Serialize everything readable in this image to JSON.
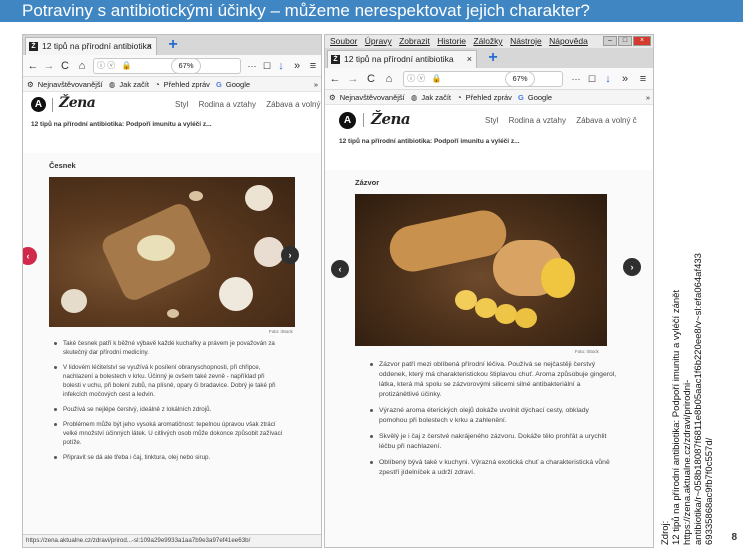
{
  "slide": {
    "title": "Potraviny s antibiotickými účinky – můžeme nerespektovat jejich charakter?",
    "page_number": "8",
    "source_lines": [
      "Zdroj:",
      "12 tipů na přírodní antibiotika: Podpoří imunitu a vyléčí zánět",
      "https://zena.aktualne.cz/zdravi/prirodni-",
      "antibiotika/r~058b18087f6811e8b05aac1f6b220ee8/v~sl:efa064af433",
      "69335868ac9fb7f0c557d/"
    ]
  },
  "left": {
    "tab_label": "12 tipů na přírodní antibiotika",
    "tab_close": "×",
    "new_tab": "+",
    "nav": {
      "back": "←",
      "forward": "→",
      "reload": "C",
      "home": "⌂",
      "info": "ⓘ ⓥ",
      "zoom": "67%",
      "more": "···",
      "pocket": "☐",
      "download": "↓",
      "overflow": "»",
      "menu": "≡"
    },
    "bookmarks": [
      "Nejnavštěvovanější",
      "Jak začít",
      "Přehled zpráv",
      "Google"
    ],
    "bookmarks_overflow": "»",
    "site": {
      "logo_letter": "A",
      "brand": "Žena",
      "nav": [
        "Styl",
        "Rodina a vztahy",
        "Zábava a volný č"
      ]
    },
    "breadcrumb": "12 tipů na přírodní antibiotika: Podpoří imunitu a vyléčí z...",
    "slide_title": "Česnek",
    "photo_credit": "Foto: iStock",
    "bullets": [
      "Také česnek patří k běžné výbavě každé kuchařky a právem je považován za skutečný dar přírodní medicíny.",
      "V lidovém léčitelství se využívá k posílení obranyschopnosti, při chřipce, nachlazení a bolestech v krku. Účinný je ovšem také zevně - například při bolesti v uchu, při bolení zubů, na plísně, opary či bradavice. Dobrý je také při infekcích močových cest a ledvin.",
      "Používá se nejlépe čerstvý, ideálně z lokálních zdrojů.",
      "Problémem může být jeho vysoká aromatičnost: tepelnou úpravou však ztrácí velké množství účinných látek. U citlivých osob může dokonce způsobit zažívací potíže.",
      "Připravit se dá ale třeba i čaj, tinktura, olej nebo sirup."
    ],
    "status_url": "https://zena.aktualne.cz/zdravi/prirod...-sl:109a29e9933a1aa7b9e3a97ef41ee63b/",
    "arrow_prev": "‹",
    "arrow_next": "›"
  },
  "right": {
    "menu": [
      "Soubor",
      "Úpravy",
      "Zobrazit",
      "Historie",
      "Záložky",
      "Nástroje",
      "Nápověda"
    ],
    "win_buttons": [
      "–",
      "□",
      "×"
    ],
    "tab_label": "12 tipů na přírodní antibiotika",
    "tab_close": "×",
    "new_tab": "+",
    "nav": {
      "back": "←",
      "forward": "→",
      "reload": "C",
      "home": "⌂",
      "info": "ⓘ ⓥ",
      "zoom": "67%",
      "more": "···",
      "pocket": "☐",
      "download": "↓",
      "overflow": "»",
      "menu": "≡"
    },
    "bookmarks": [
      "Nejnavštěvovanější",
      "Jak začít",
      "Přehled zpráv",
      "Google"
    ],
    "bookmarks_overflow": "»",
    "site": {
      "logo_letter": "A",
      "brand": "Žena",
      "nav": [
        "Styl",
        "Rodina a vztahy",
        "Zábava a volný č"
      ]
    },
    "breadcrumb": "12 tipů na přírodní antibiotika: Podpoří imunitu a vyléčí z...",
    "slide_title": "Zázvor",
    "photo_credit": "Foto: iStock",
    "bullets": [
      "Zázvor patří mezi oblíbená přírodní léčiva. Používá se nejčastěji čerstvý oddenek, který má charakteristickou štiplavou chuť. Aroma způsobuje gingerol, látka, která má spolu se zázvorovými silicemi silné antibakteriální a protizánětlivé účinky.",
      "Výrazné aroma éterických olejů dokáže uvolnit dýchací cesty, obklady pomohou při bolestech v krku a zahlenění.",
      "Skvělý je i čaj z čerstvé nakrájeného zázvoru. Dokáže tělo prohřát a urychlit léčbu při nachlazení.",
      "Oblíbený bývá také v kuchyni. Výrazná exotická chuť a charakteristická vůně zpestří jídelníček a udrží zdraví."
    ],
    "arrow_prev": "‹",
    "arrow_next": "›"
  }
}
